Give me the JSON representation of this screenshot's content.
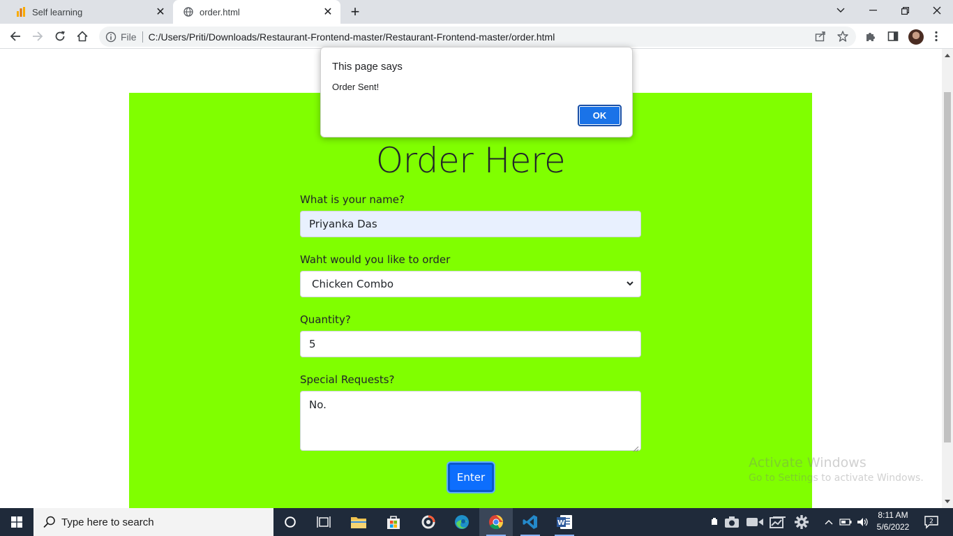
{
  "browser": {
    "tabs": [
      {
        "title": "Self learning",
        "active": false
      },
      {
        "title": "order.html",
        "active": true
      }
    ],
    "address": {
      "scheme_label": "File",
      "url": "C:/Users/Priti/Downloads/Restaurant-Frontend-master/Restaurant-Frontend-master/order.html"
    }
  },
  "page": {
    "background": "#80ff00",
    "title": "Order Here",
    "form": {
      "name_label": "What is your name?",
      "name_value": "Priyanka Das",
      "order_label": "Waht would you like to order",
      "order_value": "Chicken Combo",
      "quantity_label": "Quantity?",
      "quantity_value": "5",
      "requests_label": "Special Requests?",
      "requests_value": "No.",
      "submit_label": "Enter"
    },
    "watermark": {
      "line1": "Activate Windows",
      "line2": "Go to Settings to activate Windows."
    }
  },
  "dialog": {
    "title": "This page says",
    "message": "Order Sent!",
    "ok_label": "OK"
  },
  "taskbar": {
    "search_placeholder": "Type here to search",
    "time": "8:11 AM",
    "date": "5/6/2022",
    "notification_count": "2",
    "apps": [
      "task-view",
      "file-explorer",
      "microsoft-store",
      "snipping-tool",
      "edge",
      "chrome",
      "vscode",
      "word"
    ]
  }
}
